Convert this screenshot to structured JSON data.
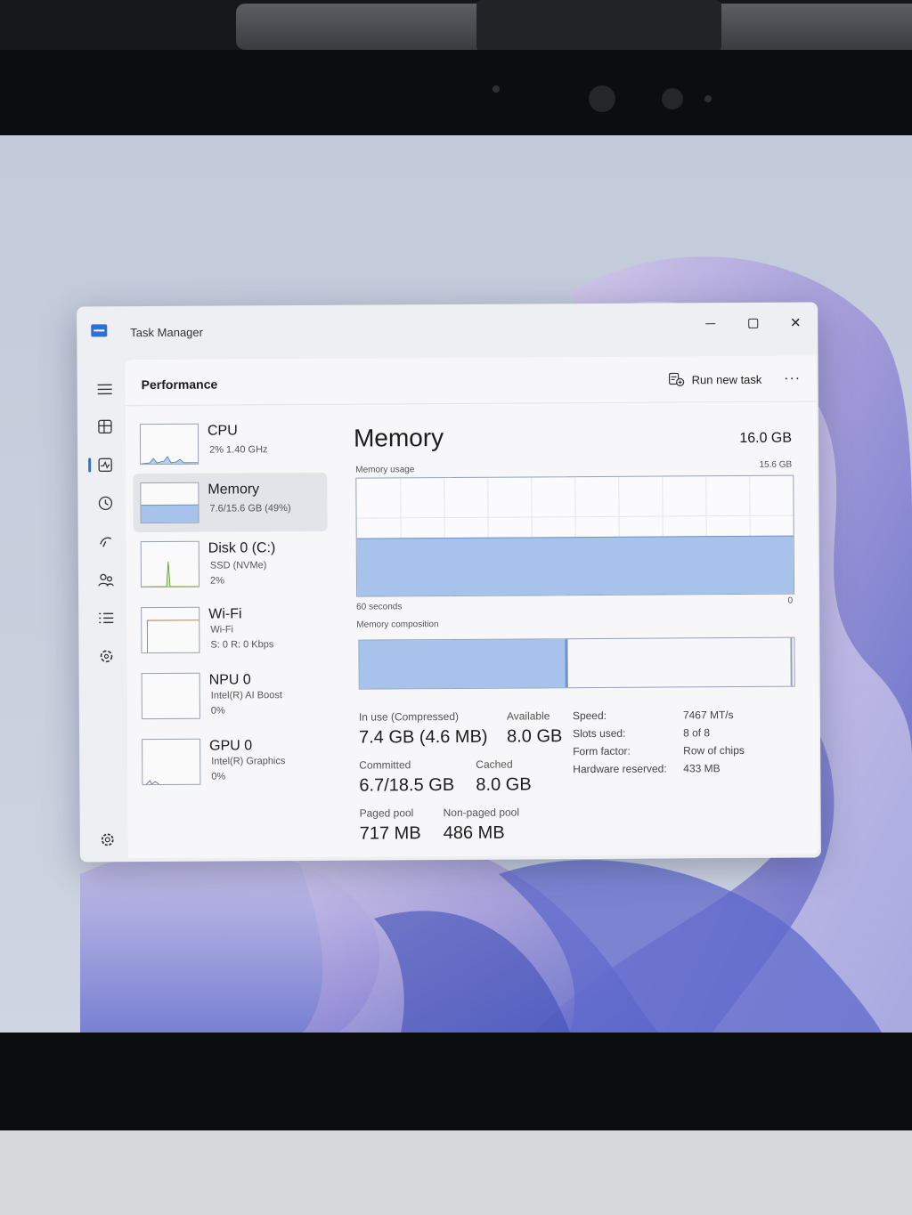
{
  "window": {
    "title": "Task Manager"
  },
  "header": {
    "page_title": "Performance",
    "run_new_task": "Run new task",
    "more": "···"
  },
  "nav": [
    "hamburger-icon",
    "processes-icon",
    "performance-icon",
    "app-history-icon",
    "startup-apps-icon",
    "users-icon",
    "details-icon",
    "services-icon",
    "settings-icon"
  ],
  "devices": [
    {
      "name": "CPU",
      "line1": "2% 1.40 GHz",
      "line2": ""
    },
    {
      "name": "Memory",
      "line1": "7.6/15.6 GB (49%)",
      "line2": ""
    },
    {
      "name": "Disk 0 (C:)",
      "line1": "SSD (NVMe)",
      "line2": "2%"
    },
    {
      "name": "Wi-Fi",
      "line1": "Wi-Fi",
      "line2": "S: 0 R: 0 Kbps"
    },
    {
      "name": "NPU 0",
      "line1": "Intel(R) AI Boost",
      "line2": "0%"
    },
    {
      "name": "GPU 0",
      "line1": "Intel(R) Graphics",
      "line2": "0%"
    }
  ],
  "memory": {
    "title": "Memory",
    "total": "16.0 GB",
    "usage_label": "Memory usage",
    "usage_max": "15.6 GB",
    "time_span": "60 seconds",
    "time_zero": "0",
    "usage_fraction": 0.49,
    "composition_label": "Memory composition",
    "composition_in_use_fraction": 0.48,
    "stats": {
      "in_use_label": "In use (Compressed)",
      "in_use_value": "7.4 GB (4.6 MB)",
      "available_label": "Available",
      "available_value": "8.0 GB",
      "committed_label": "Committed",
      "committed_value": "6.7/18.5 GB",
      "cached_label": "Cached",
      "cached_value": "8.0 GB",
      "paged_label": "Paged pool",
      "paged_value": "717 MB",
      "nonpaged_label": "Non-paged pool",
      "nonpaged_value": "486 MB"
    },
    "specs": [
      {
        "label": "Speed:",
        "value": "7467 MT/s"
      },
      {
        "label": "Slots used:",
        "value": "8 of 8"
      },
      {
        "label": "Form factor:",
        "value": "Row of chips"
      },
      {
        "label": "Hardware reserved:",
        "value": "433 MB"
      }
    ]
  },
  "colors": {
    "accent": "#2d6fd6",
    "graph_fill": "#a7c3ec",
    "graph_line": "#6e93c9"
  }
}
